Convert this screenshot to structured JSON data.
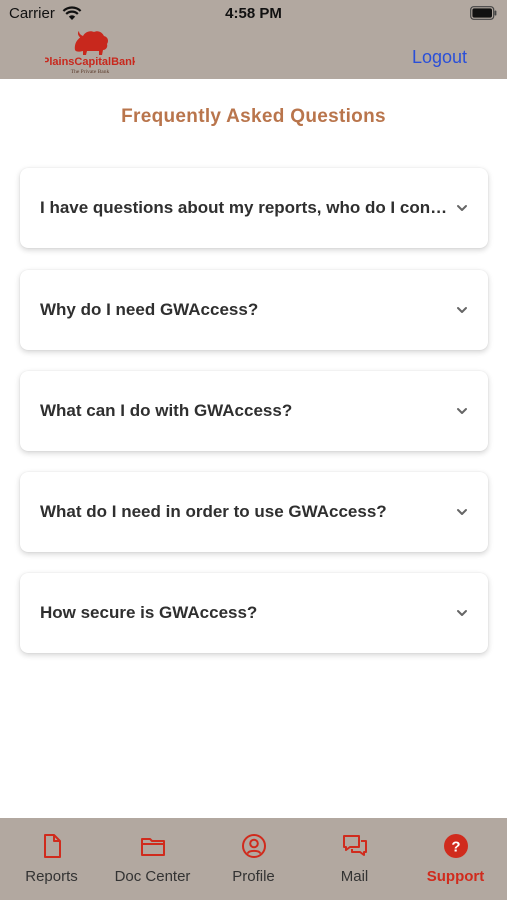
{
  "status_bar": {
    "carrier": "Carrier",
    "time": "4:58 PM"
  },
  "header": {
    "logo_text": "PlainsCapitalBank",
    "logo_subtext": "The Private Bank",
    "logout_label": "Logout",
    "logout_color": "#2a4fd8",
    "background_color": "#b2a8a0"
  },
  "main": {
    "title": "Frequently Asked Questions",
    "title_color": "#b9754c",
    "faqs": [
      {
        "question": "I have questions about my reports, who do I contact?",
        "expanded": false
      },
      {
        "question": "Why do I need GWAccess?",
        "expanded": false
      },
      {
        "question": "What can I do with GWAccess?",
        "expanded": false
      },
      {
        "question": "What do I need in order to use GWAccess?",
        "expanded": false
      },
      {
        "question": "How secure is GWAccess?",
        "expanded": false
      }
    ]
  },
  "tabbar": {
    "active_color": "#d02b1d",
    "tabs": [
      {
        "label": "Reports",
        "icon": "document-icon",
        "active": false
      },
      {
        "label": "Doc Center",
        "icon": "folder-icon",
        "active": false
      },
      {
        "label": "Profile",
        "icon": "user-circle-icon",
        "active": false
      },
      {
        "label": "Mail",
        "icon": "chat-bubbles-icon",
        "active": false
      },
      {
        "label": "Support",
        "icon": "question-circle-icon",
        "active": true
      }
    ]
  }
}
